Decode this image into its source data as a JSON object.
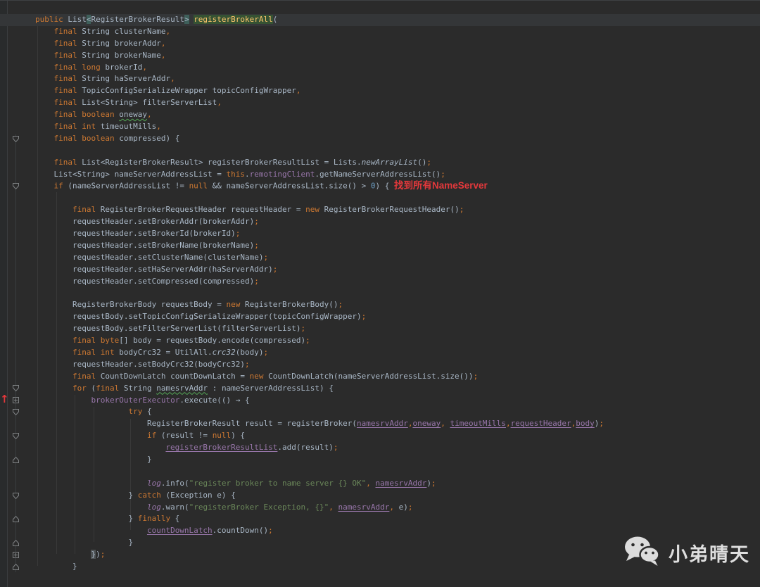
{
  "editor": {
    "theme": {
      "background": "#2B2B2B",
      "caret_row": "#343638",
      "keyword": "#CC7832",
      "default_text": "#A9B7C6",
      "field": "#9876AA",
      "string": "#6A8759",
      "number": "#6897BB",
      "method_decl": "#FFC66D",
      "annotation_red": "#E3383B"
    },
    "annotation": {
      "text": "找到所有NameServer",
      "arrow": "↑"
    },
    "fold_markers": [
      {
        "line": 11,
        "type": "down"
      },
      {
        "line": 15,
        "type": "down"
      },
      {
        "line": 32,
        "type": "down"
      },
      {
        "line": 33,
        "type": "plus"
      },
      {
        "line": 34,
        "type": "down"
      },
      {
        "line": 36,
        "type": "down"
      },
      {
        "line": 38,
        "type": "up"
      },
      {
        "line": 41,
        "type": "down"
      },
      {
        "line": 43,
        "type": "up"
      },
      {
        "line": 45,
        "type": "up"
      },
      {
        "line": 46,
        "type": "plus"
      },
      {
        "line": 47,
        "type": "up"
      }
    ],
    "code": {
      "caret_line_index": 0,
      "lines": [
        [
          [
            "kw",
            "public "
          ],
          [
            "d",
            "List"
          ],
          [
            "hlb",
            "<"
          ],
          [
            "d",
            "RegisterBrokerResult"
          ],
          [
            "hlb",
            ">"
          ],
          [
            "d",
            " "
          ],
          [
            "hlm",
            "registerBrokerAll"
          ],
          [
            "d",
            "("
          ]
        ],
        [
          [
            "d",
            "    "
          ],
          [
            "kw",
            "final "
          ],
          [
            "d",
            "String clusterName"
          ],
          [
            "kw",
            ","
          ]
        ],
        [
          [
            "d",
            "    "
          ],
          [
            "kw",
            "final "
          ],
          [
            "d",
            "String brokerAddr"
          ],
          [
            "kw",
            ","
          ]
        ],
        [
          [
            "d",
            "    "
          ],
          [
            "kw",
            "final "
          ],
          [
            "d",
            "String brokerName"
          ],
          [
            "kw",
            ","
          ]
        ],
        [
          [
            "d",
            "    "
          ],
          [
            "kw",
            "final long "
          ],
          [
            "d",
            "brokerId"
          ],
          [
            "kw",
            ","
          ]
        ],
        [
          [
            "d",
            "    "
          ],
          [
            "kw",
            "final "
          ],
          [
            "d",
            "String haServerAddr"
          ],
          [
            "kw",
            ","
          ]
        ],
        [
          [
            "d",
            "    "
          ],
          [
            "kw",
            "final "
          ],
          [
            "d",
            "TopicConfigSerializeWrapper topicConfigWrapper"
          ],
          [
            "kw",
            ","
          ]
        ],
        [
          [
            "d",
            "    "
          ],
          [
            "kw",
            "final "
          ],
          [
            "d",
            "List<String> filterServerList"
          ],
          [
            "kw",
            ","
          ]
        ],
        [
          [
            "d",
            "    "
          ],
          [
            "kw",
            "final boolean "
          ],
          [
            "typo",
            "oneway"
          ],
          [
            "kw",
            ","
          ]
        ],
        [
          [
            "d",
            "    "
          ],
          [
            "kw",
            "final int "
          ],
          [
            "d",
            "timeoutMills"
          ],
          [
            "kw",
            ","
          ]
        ],
        [
          [
            "d",
            "    "
          ],
          [
            "kw",
            "final boolean "
          ],
          [
            "d",
            "compressed) {"
          ]
        ],
        [],
        [
          [
            "d",
            "    "
          ],
          [
            "kw",
            "final "
          ],
          [
            "d",
            "List<RegisterBrokerResult> registerBrokerResultList = Lists."
          ],
          [
            "stat",
            "newArrayList"
          ],
          [
            "d",
            "()"
          ],
          [
            "kw",
            ";"
          ]
        ],
        [
          [
            "d",
            "    List<String> nameServerAddressList = "
          ],
          [
            "kw",
            "this"
          ],
          [
            "d",
            "."
          ],
          [
            "fld",
            "remotingClient"
          ],
          [
            "d",
            ".getNameServerAddressList()"
          ],
          [
            "kw",
            ";"
          ]
        ],
        [
          [
            "d",
            "    "
          ],
          [
            "kw",
            "if "
          ],
          [
            "d",
            "(nameServerAddressList != "
          ],
          [
            "kw",
            "null"
          ],
          [
            "d",
            " && nameServerAddressList.size() > "
          ],
          [
            "num",
            "0"
          ],
          [
            "d",
            ") { "
          ],
          [
            "ann",
            "找到所有NameServer"
          ]
        ],
        [],
        [
          [
            "d",
            "        "
          ],
          [
            "kw",
            "final "
          ],
          [
            "d",
            "RegisterBrokerRequestHeader requestHeader = "
          ],
          [
            "kw",
            "new "
          ],
          [
            "d",
            "RegisterBrokerRequestHeader()"
          ],
          [
            "kw",
            ";"
          ]
        ],
        [
          [
            "d",
            "        requestHeader.setBrokerAddr(brokerAddr)"
          ],
          [
            "kw",
            ";"
          ]
        ],
        [
          [
            "d",
            "        requestHeader.setBrokerId(brokerId)"
          ],
          [
            "kw",
            ";"
          ]
        ],
        [
          [
            "d",
            "        requestHeader.setBrokerName(brokerName)"
          ],
          [
            "kw",
            ";"
          ]
        ],
        [
          [
            "d",
            "        requestHeader.setClusterName(clusterName)"
          ],
          [
            "kw",
            ";"
          ]
        ],
        [
          [
            "d",
            "        requestHeader.setHaServerAddr(haServerAddr)"
          ],
          [
            "kw",
            ";"
          ]
        ],
        [
          [
            "d",
            "        requestHeader.setCompressed(compressed)"
          ],
          [
            "kw",
            ";"
          ]
        ],
        [],
        [
          [
            "d",
            "        RegisterBrokerBody requestBody = "
          ],
          [
            "kw",
            "new "
          ],
          [
            "d",
            "RegisterBrokerBody()"
          ],
          [
            "kw",
            ";"
          ]
        ],
        [
          [
            "d",
            "        requestBody.setTopicConfigSerializeWrapper(topicConfigWrapper)"
          ],
          [
            "kw",
            ";"
          ]
        ],
        [
          [
            "d",
            "        requestBody.setFilterServerList(filterServerList)"
          ],
          [
            "kw",
            ";"
          ]
        ],
        [
          [
            "d",
            "        "
          ],
          [
            "kw",
            "final byte"
          ],
          [
            "d",
            "[] body = requestBody.encode(compressed)"
          ],
          [
            "kw",
            ";"
          ]
        ],
        [
          [
            "d",
            "        "
          ],
          [
            "kw",
            "final int "
          ],
          [
            "d",
            "bodyCrc32 = UtilAll."
          ],
          [
            "stat",
            "crc32"
          ],
          [
            "d",
            "(body)"
          ],
          [
            "kw",
            ";"
          ]
        ],
        [
          [
            "d",
            "        requestHeader.setBodyCrc32(bodyCrc32)"
          ],
          [
            "kw",
            ";"
          ]
        ],
        [
          [
            "d",
            "        "
          ],
          [
            "kw",
            "final "
          ],
          [
            "d",
            "CountDownLatch countDownLatch = "
          ],
          [
            "kw",
            "new "
          ],
          [
            "d",
            "CountDownLatch(nameServerAddressList.size())"
          ],
          [
            "kw",
            ";"
          ]
        ],
        [
          [
            "d",
            "        "
          ],
          [
            "kw",
            "for "
          ],
          [
            "d",
            "("
          ],
          [
            "kw",
            "final "
          ],
          [
            "d",
            "String "
          ],
          [
            "typo",
            "namesrvAddr"
          ],
          [
            "d",
            " : nameServerAddressList) {"
          ]
        ],
        [
          [
            "d",
            "            "
          ],
          [
            "fld",
            "brokerOuterExecutor"
          ],
          [
            "d",
            ".execute(() → {"
          ]
        ],
        [
          [
            "d",
            "                    "
          ],
          [
            "kw",
            "try"
          ],
          [
            "d",
            " {"
          ]
        ],
        [
          [
            "d",
            "                        RegisterBrokerResult result = registerBroker("
          ],
          [
            "fldu",
            "namesrvAddr"
          ],
          [
            "kw",
            ","
          ],
          [
            "fldu",
            "oneway"
          ],
          [
            "kw",
            ","
          ],
          [
            "d",
            " "
          ],
          [
            "fldu",
            "timeoutMills"
          ],
          [
            "kw",
            ","
          ],
          [
            "fldu",
            "requestHeader"
          ],
          [
            "kw",
            ","
          ],
          [
            "fldu",
            "body"
          ],
          [
            "d",
            ")"
          ],
          [
            "kw",
            ";"
          ]
        ],
        [
          [
            "d",
            "                        "
          ],
          [
            "kw",
            "if "
          ],
          [
            "d",
            "(result != "
          ],
          [
            "kw",
            "null"
          ],
          [
            "d",
            ") {"
          ]
        ],
        [
          [
            "d",
            "                            "
          ],
          [
            "fldu",
            "registerBrokerResultList"
          ],
          [
            "d",
            ".add(result)"
          ],
          [
            "kw",
            ";"
          ]
        ],
        [
          [
            "d",
            "                        }"
          ]
        ],
        [],
        [
          [
            "d",
            "                        "
          ],
          [
            "logf",
            "log"
          ],
          [
            "d",
            ".info("
          ],
          [
            "str",
            "\"register broker to name server {} OK\""
          ],
          [
            "kw",
            ","
          ],
          [
            "d",
            " "
          ],
          [
            "fldu",
            "namesrvAddr"
          ],
          [
            "d",
            ")"
          ],
          [
            "kw",
            ";"
          ]
        ],
        [
          [
            "d",
            "                    } "
          ],
          [
            "kw",
            "catch "
          ],
          [
            "d",
            "(Exception e) {"
          ]
        ],
        [
          [
            "d",
            "                        "
          ],
          [
            "logf",
            "log"
          ],
          [
            "d",
            ".warn("
          ],
          [
            "str",
            "\"registerBroker Exception, {}\""
          ],
          [
            "kw",
            ","
          ],
          [
            "d",
            " "
          ],
          [
            "fldu",
            "namesrvAddr"
          ],
          [
            "kw",
            ","
          ],
          [
            "d",
            " e)"
          ],
          [
            "kw",
            ";"
          ]
        ],
        [
          [
            "d",
            "                    } "
          ],
          [
            "kw",
            "finally"
          ],
          [
            "d",
            " {"
          ]
        ],
        [
          [
            "d",
            "                        "
          ],
          [
            "fldu",
            "countDownLatch"
          ],
          [
            "d",
            ".countDown()"
          ],
          [
            "kw",
            ";"
          ]
        ],
        [
          [
            "d",
            "                    }"
          ]
        ],
        [
          [
            "d",
            "            "
          ],
          [
            "bm",
            "}"
          ],
          [
            "d",
            ")"
          ],
          [
            "kw",
            ";"
          ]
        ],
        [
          [
            "d",
            "        }"
          ]
        ]
      ]
    }
  },
  "watermark": {
    "text": "小弟晴天",
    "icon": "wechat-icon"
  }
}
